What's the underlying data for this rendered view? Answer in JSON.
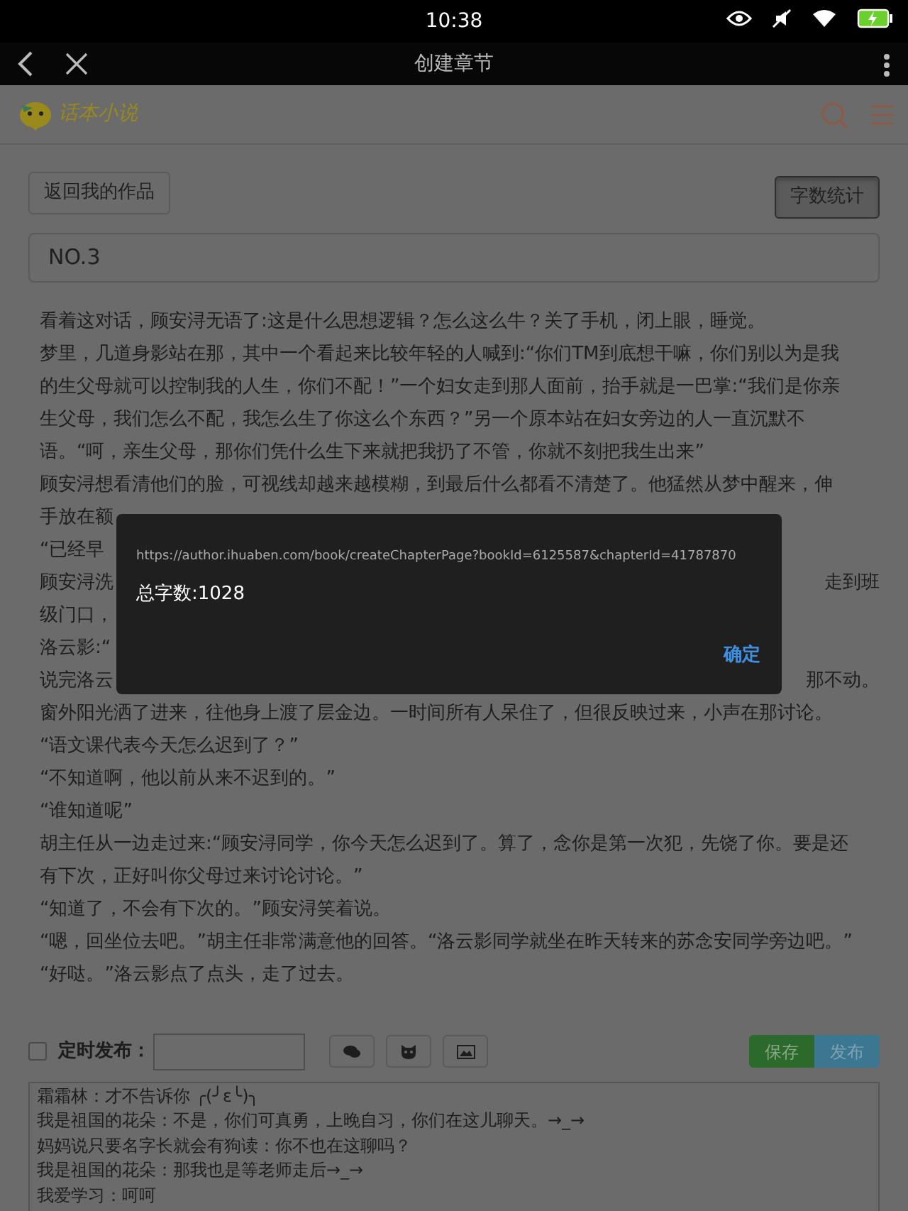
{
  "status_bar": {
    "time": "10:38",
    "battery_charging": true
  },
  "title_bar": {
    "title": "创建章节"
  },
  "header": {
    "logo_text": "话本小说"
  },
  "toolbar": {
    "back_button": "返回我的作品",
    "count_button": "字数统计",
    "count_button_pressed": true
  },
  "chapter_title": {
    "value": "NO.3"
  },
  "body_lines": [
    {
      "left": "看着这对话，顾安浔无语了:这是什么思想逻辑？怎么这么牛？关了手机，闭上眼，睡觉。"
    },
    {
      "left": "梦里，几道身影站在那，其中一个看起来比较年轻的人喊到:“你们TM到底想干嘛，你们别以为是我"
    },
    {
      "left": "的生父母就可以控制我的人生，你们不配！”一个妇女走到那人面前，抬手就是一巴掌:“我们是你亲"
    },
    {
      "left": "生父母，我们怎么不配，我怎么生了你这么个东西？”另一个原本站在妇女旁边的人一直沉默不"
    },
    {
      "left": "语。“呵，亲生父母，那你们凭什么生下来就把我扔了不管，你就不刻把我生出来”"
    },
    {
      "left": "顾安浔想看清他们的脸，可视线却越来越模糊，到最后什么都看不清楚了。他猛然从梦中醒来，伸"
    },
    {
      "left": "手放在额"
    },
    {
      "left": "“已经早"
    },
    {
      "left": "顾安浔洗",
      "right": "走到班"
    },
    {
      "left": "级门口，"
    },
    {
      "left": "洛云影:“"
    },
    {
      "left": "说完洛云",
      "right": "那不动。"
    },
    {
      "left": "窗外阳光洒了进来，往他身上渡了层金边。一时间所有人呆住了，但很反映过来，小声在那讨论。"
    },
    {
      "left": "“语文课代表今天怎么迟到了？”"
    },
    {
      "left": "“不知道啊，他以前从来不迟到的。”"
    },
    {
      "left": "“谁知道呢”"
    },
    {
      "left": "胡主任从一边走过来:“顾安浔同学，你今天怎么迟到了。算了，念你是第一次犯，先饶了你。要是还"
    },
    {
      "left": "有下次，正好叫你父母过来讨论讨论。”"
    },
    {
      "left": "“知道了，不会有下次的。”顾安浔笑着说。"
    },
    {
      "left": "“嗯，回坐位去吧。”胡主任非常满意他的回答。“洛云影同学就坐在昨天转来的苏念安同学旁边吧。”"
    },
    {
      "left": "“好哒。”洛云影点了点头，走了过去。"
    }
  ],
  "publish_bar": {
    "timed_checked": false,
    "timed_label": "定时发布：",
    "save_button": "保存",
    "publish_button": "发布"
  },
  "comments": [
    "霜霜林：才不告诉你 ╭(╯ε╰)╮",
    "我是祖国的花朵：不是，你们可真勇，上晚自习，你们在这儿聊天。→_→",
    "妈妈说只要名字长就会有狗读：你不也在这聊吗？",
    "我是祖国的花朵：那我也是等老师走后→_→",
    "我爱学习：呵呵"
  ],
  "dialog": {
    "url": "https://author.ihuaben.com/book/createChapterPage?bookId=6125587&chapterId=41787870",
    "message": "总字数:1028",
    "ok_button": "确定"
  }
}
